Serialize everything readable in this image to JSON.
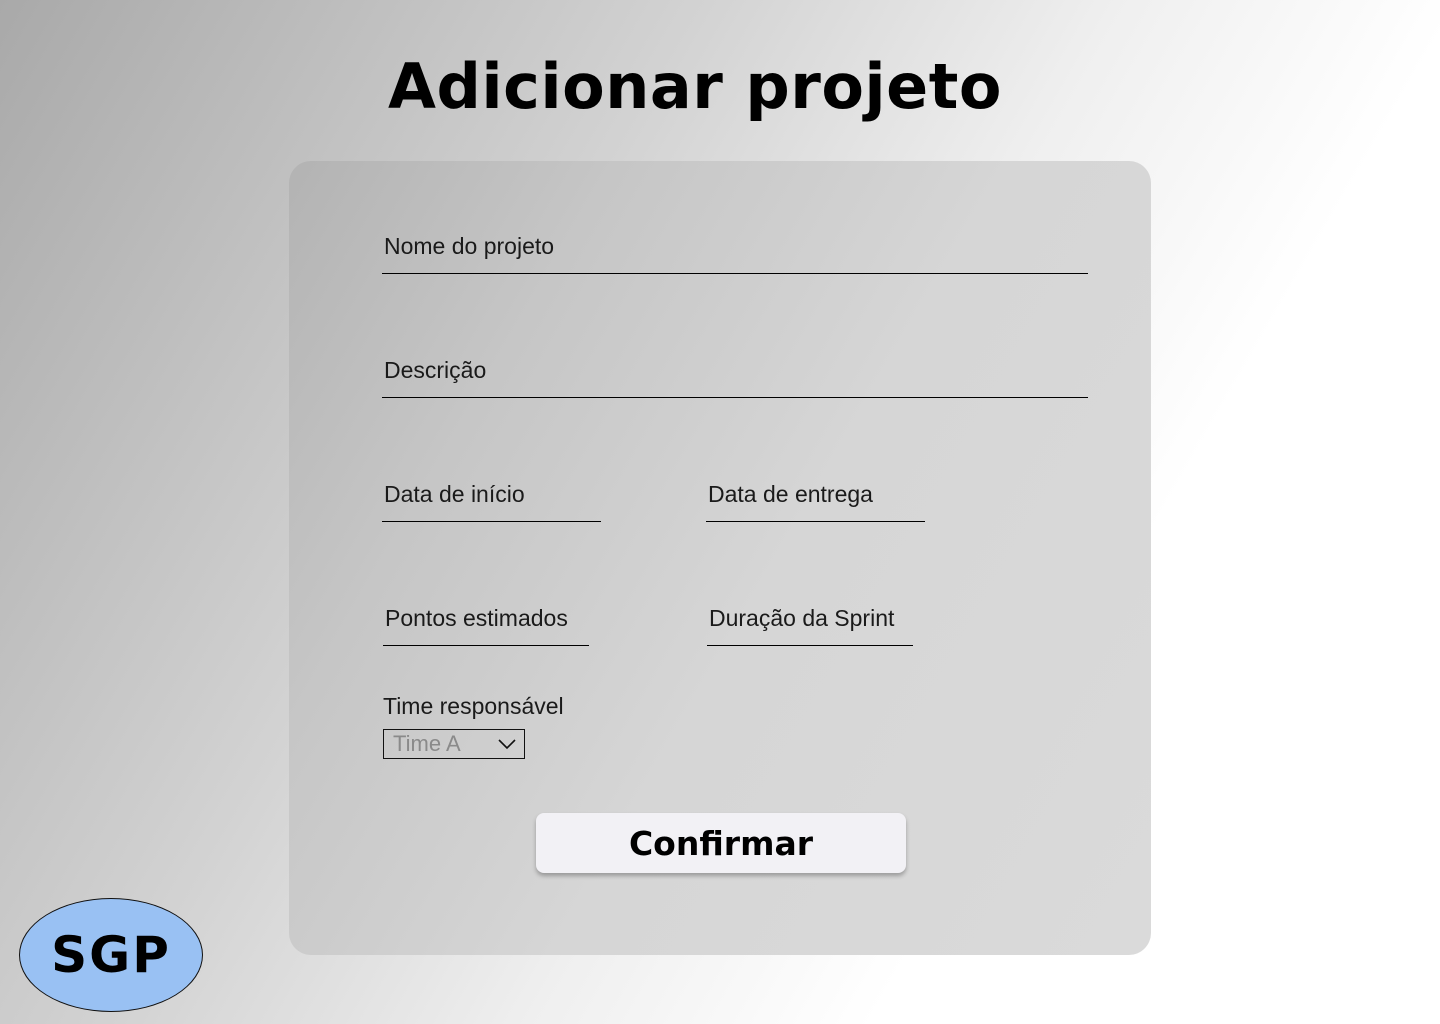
{
  "page": {
    "title": "Adicionar projeto"
  },
  "form": {
    "nome_label": "Nome do projeto",
    "descricao_label": "Descrição",
    "data_inicio_label": "Data de início",
    "data_entrega_label": "Data de entrega",
    "pontos_label": "Pontos estimados",
    "duracao_sprint_label": "Duração da Sprint",
    "time_label": "Time responsável",
    "time_selected": "Time A",
    "confirm_label": "Confirmar"
  },
  "logo": {
    "text": "SGP",
    "color": "#99c1f3"
  },
  "icons": {
    "dropdown": "chevron-down-icon"
  }
}
